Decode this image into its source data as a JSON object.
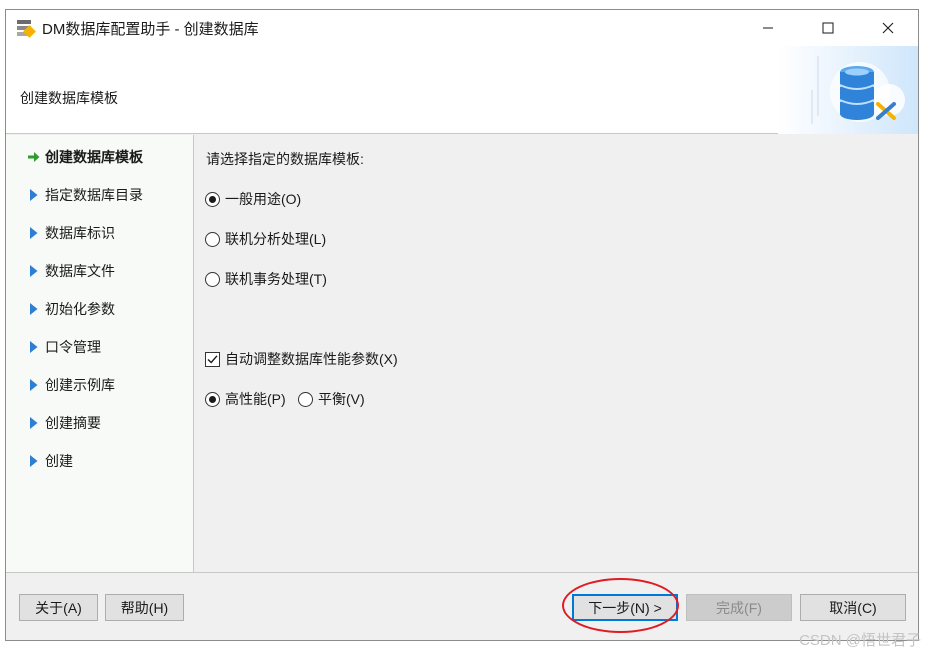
{
  "window": {
    "title": "DM数据库配置助手 - 创建数据库"
  },
  "header": {
    "title": "创建数据库模板"
  },
  "sidebar": {
    "items": [
      {
        "label": "创建数据库模板",
        "state": "current"
      },
      {
        "label": "指定数据库目录",
        "state": "pending"
      },
      {
        "label": "数据库标识",
        "state": "pending"
      },
      {
        "label": "数据库文件",
        "state": "pending"
      },
      {
        "label": "初始化参数",
        "state": "pending"
      },
      {
        "label": "口令管理",
        "state": "pending"
      },
      {
        "label": "创建示例库",
        "state": "pending"
      },
      {
        "label": "创建摘要",
        "state": "pending"
      },
      {
        "label": "创建",
        "state": "pending"
      }
    ]
  },
  "main": {
    "prompt": "请选择指定的数据库模板:",
    "templates": [
      {
        "label": "一般用途(O)",
        "checked": true
      },
      {
        "label": "联机分析处理(L)",
        "checked": false
      },
      {
        "label": "联机事务处理(T)",
        "checked": false
      }
    ],
    "auto_tune": {
      "label": "自动调整数据库性能参数(X)",
      "checked": true
    },
    "performance": [
      {
        "label": "高性能(P)",
        "checked": true
      },
      {
        "label": "平衡(V)",
        "checked": false
      }
    ]
  },
  "footer": {
    "about": "关于(A)",
    "help": "帮助(H)",
    "next": "下一步(N) >",
    "finish": "完成(F)",
    "cancel": "取消(C)"
  },
  "watermark": "CSDN @悟世君子",
  "colors": {
    "accent": "#0078d7",
    "current_arrow": "#2e9b2e",
    "pending_arrow": "#2d7fd3",
    "annotation": "#e01b24"
  },
  "icons": {
    "app": "dm-app-icon",
    "minimize": "minimize-icon",
    "maximize": "maximize-icon",
    "close": "close-icon",
    "current_step": "green-arrow-icon",
    "pending_step": "blue-triangle-icon",
    "header_art": "database-config-icon"
  }
}
